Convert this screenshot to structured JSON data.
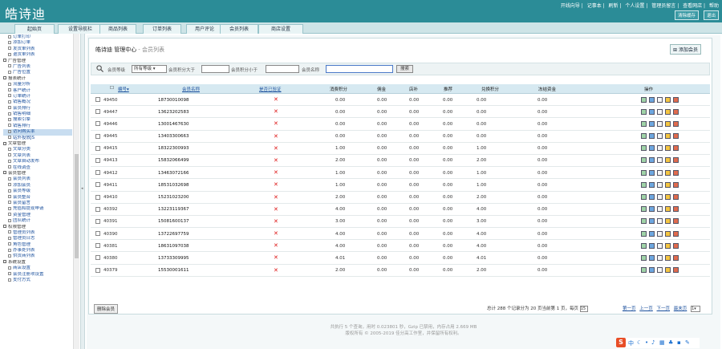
{
  "header": {
    "logo": "皓诗迪",
    "links": [
      "开线向导",
      "记事本",
      "刷新",
      "个人设置",
      "管理员留言",
      "查看网店",
      "帮助"
    ],
    "buttons": [
      "清除缓存",
      "退出"
    ]
  },
  "nav": {
    "tabs": [
      "起始页",
      "设置导航栏",
      "商品列表",
      "订单列表",
      "用户评论",
      "会员列表",
      "商店设置"
    ]
  },
  "sidebar": {
    "items": [
      {
        "label": "订单打印",
        "type": "child"
      },
      {
        "label": "添加订单",
        "type": "child"
      },
      {
        "label": "发货单列表",
        "type": "child"
      },
      {
        "label": "退货单列表",
        "type": "child"
      },
      {
        "label": "广告管理",
        "type": "group"
      },
      {
        "label": "广告列表",
        "type": "child"
      },
      {
        "label": "广告位置",
        "type": "child"
      },
      {
        "label": "报表统计",
        "type": "group"
      },
      {
        "label": "流量分析",
        "type": "child"
      },
      {
        "label": "客户统计",
        "type": "child"
      },
      {
        "label": "订单统计",
        "type": "child"
      },
      {
        "label": "销售概况",
        "type": "child"
      },
      {
        "label": "会员排行",
        "type": "child"
      },
      {
        "label": "销售明细",
        "type": "child"
      },
      {
        "label": "搜索引擎",
        "type": "child"
      },
      {
        "label": "销售排行",
        "type": "child"
      },
      {
        "label": "访问购买率",
        "type": "child",
        "highlight": true
      },
      {
        "label": "站外投放JS",
        "type": "child"
      },
      {
        "label": "文章管理",
        "type": "group"
      },
      {
        "label": "文章分类",
        "type": "child"
      },
      {
        "label": "文章列表",
        "type": "child"
      },
      {
        "label": "文章自动发布",
        "type": "child"
      },
      {
        "label": "在线调查",
        "type": "child"
      },
      {
        "label": "会员管理",
        "type": "group"
      },
      {
        "label": "会员列表",
        "type": "child"
      },
      {
        "label": "添加会员",
        "type": "child"
      },
      {
        "label": "会员等级",
        "type": "child"
      },
      {
        "label": "会员整合",
        "type": "child"
      },
      {
        "label": "会员留言",
        "type": "child"
      },
      {
        "label": "充值和提现申请",
        "type": "child"
      },
      {
        "label": "资金管理",
        "type": "child"
      },
      {
        "label": "团队统计",
        "type": "child"
      },
      {
        "label": "权限管理",
        "type": "group"
      },
      {
        "label": "管理员列表",
        "type": "child"
      },
      {
        "label": "管理员日志",
        "type": "child"
      },
      {
        "label": "角色管理",
        "type": "child"
      },
      {
        "label": "办事处列表",
        "type": "child"
      },
      {
        "label": "供货商列表",
        "type": "child"
      },
      {
        "label": "系统设置",
        "type": "group"
      },
      {
        "label": "商店设置",
        "type": "child"
      },
      {
        "label": "会员注册项设置",
        "type": "child"
      },
      {
        "label": "支付方式",
        "type": "child"
      }
    ]
  },
  "page": {
    "title": "皓诗迪 管理中心",
    "subtitle": "- 会员列表",
    "add_button": "添加会员"
  },
  "search": {
    "level_label": "会员等级",
    "level_value": "所有等级",
    "points_gt_label": "会员积分大于",
    "points_lt_label": "会员积分小于",
    "name_label": "会员名称",
    "submit": "搜索"
  },
  "table": {
    "headers": [
      "编号",
      "会员名称",
      "是否已验证",
      "消费积分",
      "佣金",
      "店补",
      "推荐",
      "兑换积分",
      "冻结资金",
      "操作"
    ],
    "rows": [
      {
        "id": "49450",
        "name": "18730010098",
        "points": "0.00",
        "commission": "0.00",
        "subsidy": "0.00",
        "referral": "0.00",
        "exchange": "0.00",
        "frozen": "0.00"
      },
      {
        "id": "49447",
        "name": "13623202583",
        "points": "0.00",
        "commission": "0.00",
        "subsidy": "0.00",
        "referral": "0.00",
        "exchange": "0.00",
        "frozen": "0.00"
      },
      {
        "id": "49446",
        "name": "13001467630",
        "points": "0.00",
        "commission": "0.00",
        "subsidy": "0.00",
        "referral": "0.00",
        "exchange": "0.00",
        "frozen": "0.00"
      },
      {
        "id": "49445",
        "name": "13403300663",
        "points": "0.00",
        "commission": "0.00",
        "subsidy": "0.00",
        "referral": "0.00",
        "exchange": "0.00",
        "frozen": "0.00"
      },
      {
        "id": "49415",
        "name": "18322300993",
        "points": "1.00",
        "commission": "0.00",
        "subsidy": "0.00",
        "referral": "0.00",
        "exchange": "1.00",
        "frozen": "0.00"
      },
      {
        "id": "49413",
        "name": "15832066499",
        "points": "2.00",
        "commission": "0.00",
        "subsidy": "0.00",
        "referral": "0.00",
        "exchange": "2.00",
        "frozen": "0.00"
      },
      {
        "id": "49412",
        "name": "13463072166",
        "points": "1.00",
        "commission": "0.00",
        "subsidy": "0.00",
        "referral": "0.00",
        "exchange": "1.00",
        "frozen": "0.00"
      },
      {
        "id": "49411",
        "name": "18531032698",
        "points": "1.00",
        "commission": "0.00",
        "subsidy": "0.00",
        "referral": "0.00",
        "exchange": "1.00",
        "frozen": "0.00"
      },
      {
        "id": "49410",
        "name": "15231023200",
        "points": "2.00",
        "commission": "0.00",
        "subsidy": "0.00",
        "referral": "0.00",
        "exchange": "2.00",
        "frozen": "0.00"
      },
      {
        "id": "40392",
        "name": "13223119367",
        "points": "4.00",
        "commission": "0.00",
        "subsidy": "0.00",
        "referral": "0.00",
        "exchange": "4.00",
        "frozen": "0.00"
      },
      {
        "id": "40391",
        "name": "15081600137",
        "points": "3.00",
        "commission": "0.00",
        "subsidy": "0.00",
        "referral": "0.00",
        "exchange": "3.00",
        "frozen": "0.00"
      },
      {
        "id": "40390",
        "name": "13722697759",
        "points": "4.00",
        "commission": "0.00",
        "subsidy": "0.00",
        "referral": "0.00",
        "exchange": "4.00",
        "frozen": "0.00"
      },
      {
        "id": "40381",
        "name": "18631097038",
        "points": "4.00",
        "commission": "0.00",
        "subsidy": "0.00",
        "referral": "0.00",
        "exchange": "4.00",
        "frozen": "0.00"
      },
      {
        "id": "40380",
        "name": "13733309995",
        "points": "4.01",
        "commission": "0.00",
        "subsidy": "0.00",
        "referral": "0.00",
        "exchange": "4.01",
        "frozen": "0.00"
      },
      {
        "id": "40379",
        "name": "15530001611",
        "points": "2.00",
        "commission": "0.00",
        "subsidy": "0.00",
        "referral": "0.00",
        "exchange": "2.00",
        "frozen": "0.00"
      }
    ]
  },
  "pagination": {
    "delete_button": "删除会员",
    "summary": "总计 288 个记录分为 20 页当前第 1 页，每页",
    "per_page": "15",
    "first": "第一页",
    "prev": "上一页",
    "next": "下一页",
    "last": "最末页",
    "page_select": "1"
  },
  "footer": {
    "line1": "共执行 5 个查询，用时 0.023801 秒，Gzip 已禁用，内存占用 2.669 MB",
    "line2": "版权所有 © 2005-2019 佳分高工作室，并保留所有权利。"
  },
  "tray": {
    "ime_label": "S",
    "ime_mode": "中"
  }
}
